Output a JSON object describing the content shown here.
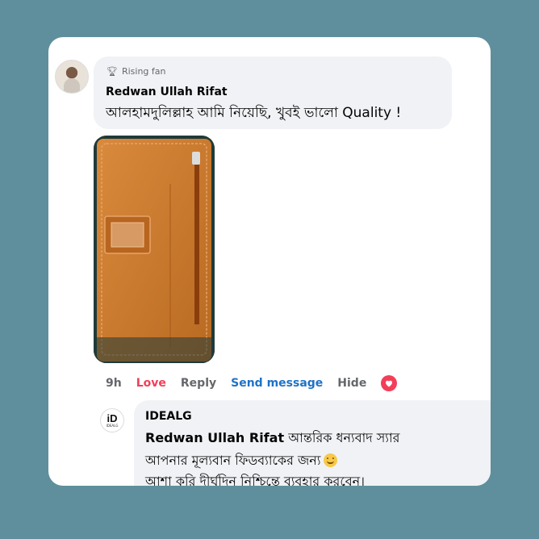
{
  "comment": {
    "badge": "Rising fan",
    "badge_icon": "trophy-icon",
    "author": "Redwan Ullah Rifat",
    "text": "আলহামদুলিল্লাহ আমি নিয়েছি, খুবই ভালো Quality !",
    "photo": "orange leather zip folder"
  },
  "actions": {
    "time": "9h",
    "love": "Love",
    "reply": "Reply",
    "send_message": "Send message",
    "hide": "Hide",
    "reaction_icon": "heart-icon"
  },
  "reply": {
    "avatar_logo": "iD",
    "avatar_sub": "IDEALG",
    "author": "IDEALG",
    "mention": "Redwan Ullah Rifat",
    "line1": "আন্তরিক ধন্যবাদ স্যার",
    "line2": "আপনার মূল্যবান ফিডব্যাকের জন্য",
    "line3": "আশা করি দীর্ঘদিন নিশ্চিন্তে ব্যবহার করবেন।"
  },
  "colors": {
    "background": "#5f8f9c",
    "bubble": "#f0f2f5",
    "love": "#f33e58",
    "link": "#1e72c7"
  }
}
